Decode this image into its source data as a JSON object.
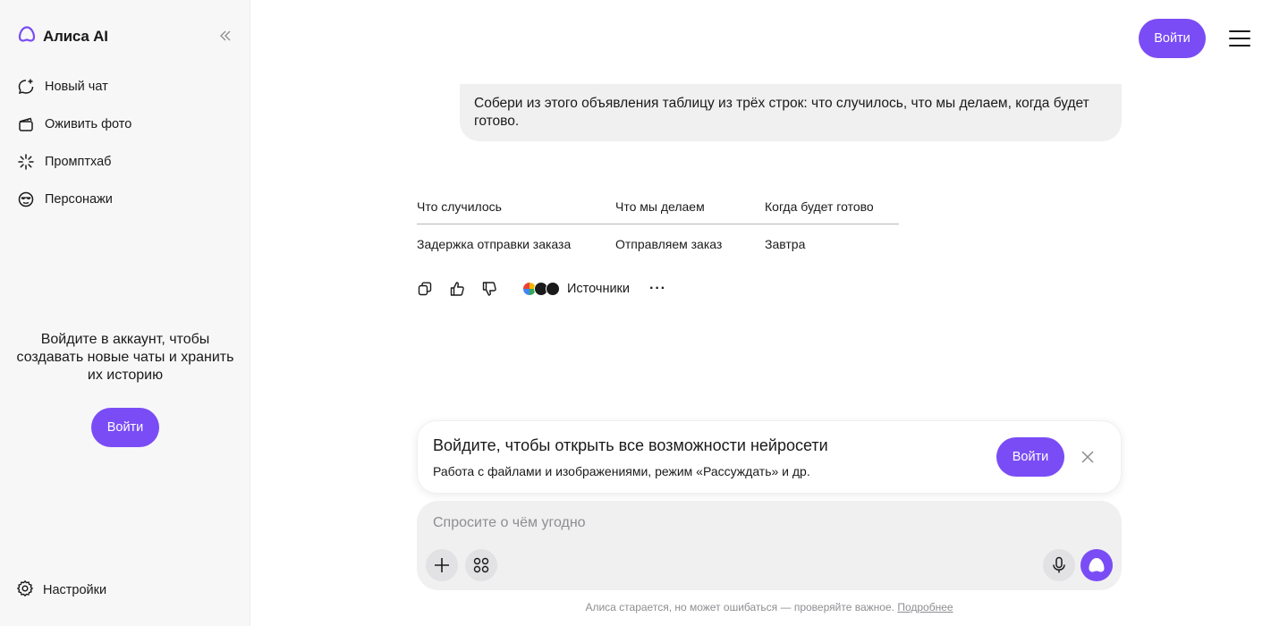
{
  "sidebar": {
    "brand": "Алиса AI",
    "items": [
      {
        "label": "Новый чат",
        "icon": "new-chat-icon"
      },
      {
        "label": "Оживить фото",
        "icon": "animate-photo-icon"
      },
      {
        "label": "Промптхаб",
        "icon": "sparkle-icon"
      },
      {
        "label": "Персонажи",
        "icon": "characters-icon"
      }
    ],
    "promo_text": "Войдите в аккаунт, чтобы создавать новые чаты и хранить их историю",
    "promo_button": "Войти",
    "settings_label": "Настройки"
  },
  "header": {
    "login_button": "Войти"
  },
  "chat": {
    "user_message": "Собери из этого объявления таблицу из трёх строк: что случилось, что мы делаем, когда будет готово.",
    "table": {
      "headers": [
        "Что случилось",
        "Что мы делаем",
        "Когда будет готово"
      ],
      "rows": [
        [
          "Задержка отправки заказа",
          "Отправляем заказ",
          "Завтра"
        ]
      ]
    },
    "actions": {
      "sources_label": "Источники",
      "more_label": "···"
    }
  },
  "banner": {
    "title": "Войдите, чтобы открыть все возможности нейросети",
    "subtitle": "Работа с файлами и изображениями, режим «Рассуждать» и др.",
    "button": "Войти"
  },
  "composer": {
    "placeholder": "Спросите о чём угодно"
  },
  "footer": {
    "note": "Алиса старается, но может ошибаться — проверяйте важное.",
    "link": "Подробнее"
  },
  "colors": {
    "accent": "#7a4cf5",
    "sidebar_bg": "#f7f7f8",
    "bubble_bg": "#f0f0f1"
  }
}
